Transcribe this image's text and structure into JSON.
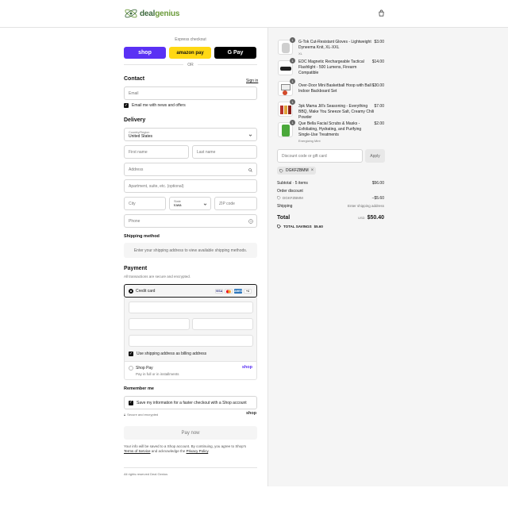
{
  "brand": {
    "name_part1": "deal",
    "name_part2": "genius"
  },
  "express": {
    "label": "Express checkout",
    "shop_label": "shop",
    "amazon_label": "amazon pay",
    "gpay_label": "G Pay",
    "or_label": "OR"
  },
  "contact": {
    "title": "Contact",
    "signin_label": "Sign in",
    "email_placeholder": "Email",
    "news_label": "Email me with news and offers"
  },
  "delivery": {
    "title": "Delivery",
    "country_label": "Country/Region",
    "country_value": "United States",
    "first_name": "First name",
    "last_name": "Last name",
    "address": "Address",
    "apartment": "Apartment, suite, etc. (optional)",
    "city": "City",
    "state_label": "State",
    "state_value": "Iowa",
    "zip": "ZIP code",
    "phone": "Phone"
  },
  "shipping": {
    "title": "Shipping method",
    "message": "Enter your shipping address to view available shipping methods."
  },
  "payment": {
    "title": "Payment",
    "subtitle": "All transactions are secure and encrypted.",
    "credit_card_label": "Credit card",
    "card_visa": "VISA",
    "card_amex": "AMEX",
    "card_more": "+4",
    "billing_label": "Use shipping address as billing address",
    "shoppay_label": "Shop Pay",
    "shoppay_sub": "Pay in full or in installments",
    "shoppay_logo": "shop"
  },
  "remember": {
    "title": "Remember me",
    "save_label": "Save my information for a faster checkout with a Shop account",
    "secure_label": "Secure and encrypted",
    "shop_logo": "shop"
  },
  "pay_now_label": "Pay now",
  "legal": {
    "text1": "Your info will be saved to a Shop account. By continuing, you agree to Shop's",
    "terms": "Terms of Service",
    "text2": " and acknowledge the ",
    "privacy": "Privacy Policy",
    "text3": "."
  },
  "footer": {
    "rights": "All rights reserved Deal Genius"
  },
  "cart": {
    "items": [
      {
        "qty": "1",
        "name": "G-Tok Cut-Resistant Gloves - Lightweight Dyneema Knit, XL-XXL",
        "variant": "XL",
        "price": "$3.00",
        "color": "#cfcfcf"
      },
      {
        "qty": "1",
        "name": "EDC Magnetic Rechargeable Tactical Flashlight - 500 Lumens, Firearm Compatible",
        "variant": "",
        "price": "$14.00",
        "color": "#222222"
      },
      {
        "qty": "1",
        "name": "Over-Door Mini Basketball Hoop with Ball - Indoor Backboard Set",
        "variant": "",
        "price": "$30.00",
        "color": "#d24a2a"
      },
      {
        "qty": "1",
        "name": "3pk Mama Jill's Seasoning - Everything BBQ, Make You Sneeze Salt, Creamy Chili Powder",
        "variant": "",
        "price": "$7.00",
        "color": "#b8322a"
      },
      {
        "qty": "1",
        "name": "Que Bella Facial Scrubs & Masks - Exfoliating, Hydrating, and Purifying Single-Use Treatments",
        "variant": "Energizing Mint",
        "price": "$2.00",
        "color": "#4aa83a"
      }
    ],
    "discount_placeholder": "Discount code or gift card",
    "apply_label": "Apply",
    "code_tag": "DGKFZBMM",
    "subtotal_label": "Subtotal · 5 items",
    "subtotal_value": "$56.00",
    "order_discount_label": "Order discount",
    "order_discount_code": "DGKFZBMM",
    "order_discount_value": "−$5.60",
    "shipping_label": "Shipping",
    "shipping_value": "Enter shipping address",
    "total_label": "Total",
    "total_currency": "USD",
    "total_value": "$50.40",
    "savings_label": "TOTAL SAVINGS",
    "savings_value": "$5.60"
  }
}
